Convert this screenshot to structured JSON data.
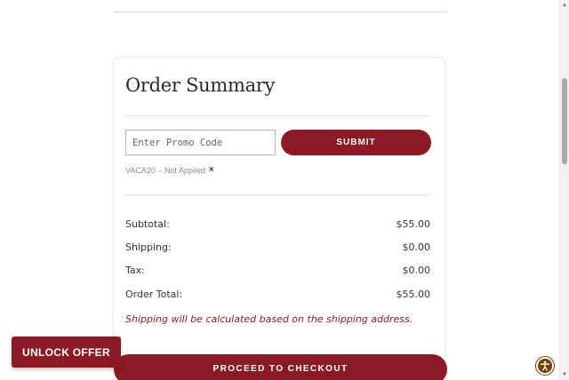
{
  "summary": {
    "title": "Order Summary",
    "promo": {
      "placeholder": "Enter Promo Code",
      "value": "",
      "submit_label": "SUBMIT",
      "status_text": "VACA20 – Not Applied",
      "remove_symbol": "×"
    },
    "rows": [
      {
        "label": "Subtotal:",
        "value": "$55.00"
      },
      {
        "label": "Shipping:",
        "value": "$0.00"
      },
      {
        "label": "Tax:",
        "value": "$0.00"
      },
      {
        "label": "Order Total:",
        "value": "$55.00"
      }
    ],
    "shipping_note": "Shipping will be calculated based on the shipping address."
  },
  "buttons": {
    "checkout_label": "PROCEED TO CHECKOUT",
    "unlock_label": "UNLOCK OFFER"
  },
  "icons": {
    "remove": "close-icon",
    "accessibility": "accessibility-icon"
  },
  "colors": {
    "accent": "#8c1a26",
    "accessibility_button": "#7a3d00",
    "muted_text": "#8a8a8a"
  }
}
